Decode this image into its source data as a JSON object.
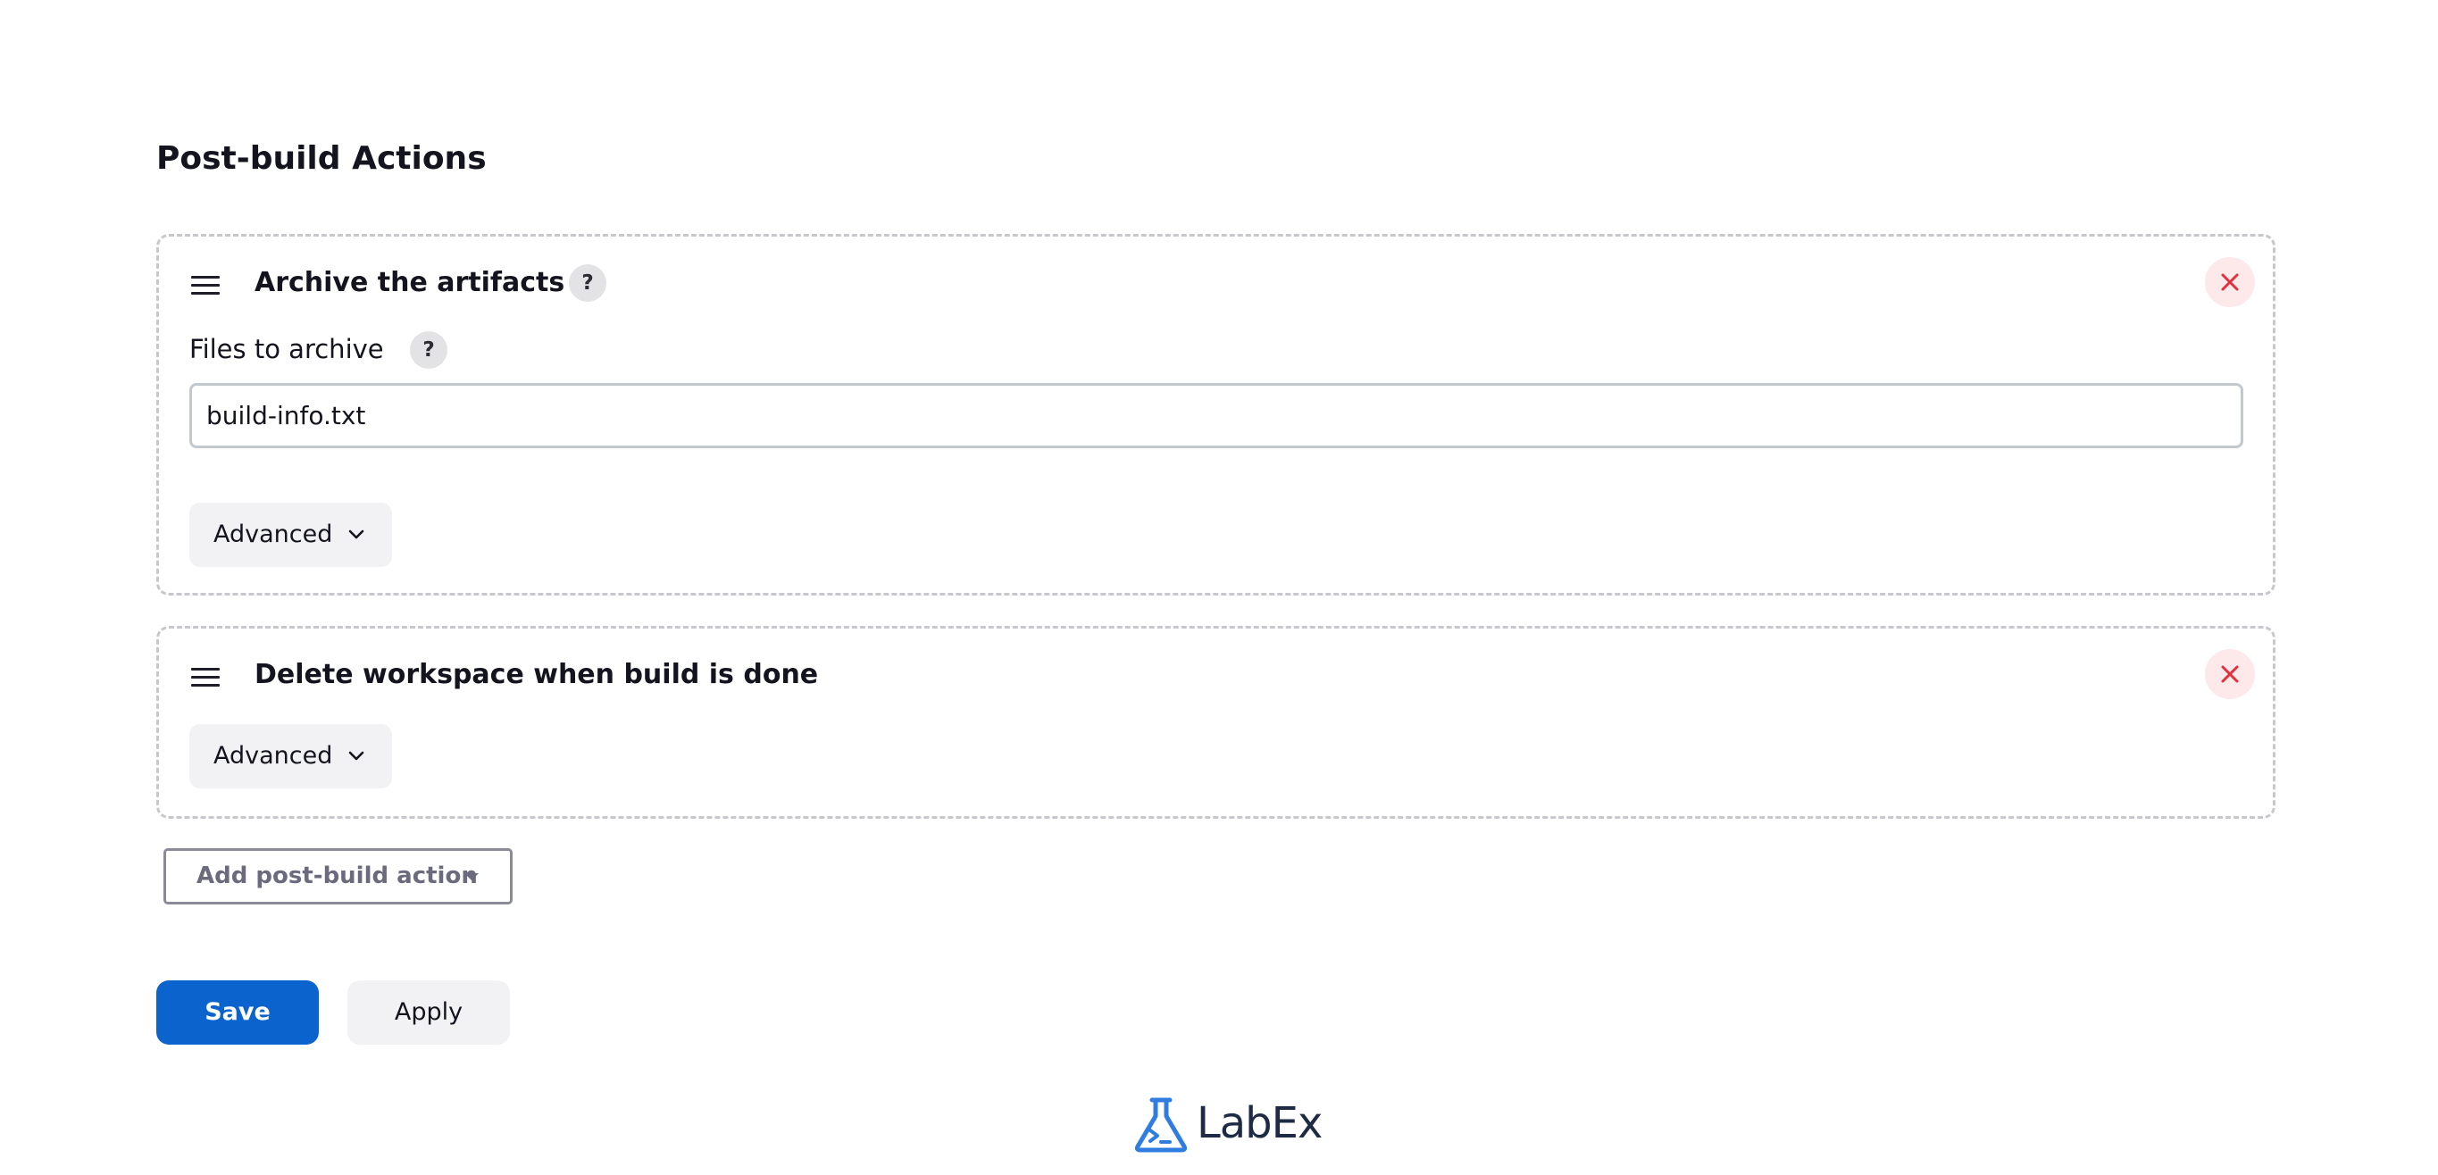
{
  "section": {
    "title": "Post-build Actions"
  },
  "actions": [
    {
      "title": "Archive the artifacts",
      "help": "?",
      "field_label": "Files to archive",
      "field_help": "?",
      "field_value": "build-info.txt",
      "advanced_label": "Advanced"
    },
    {
      "title": "Delete workspace when build is done",
      "advanced_label": "Advanced"
    }
  ],
  "add_action": {
    "label": "Add post-build action"
  },
  "buttons": {
    "save": "Save",
    "apply": "Apply"
  },
  "logo": {
    "text": "LabEx"
  },
  "colors": {
    "primary": "#0b63ce",
    "close_icon": "#e0323e",
    "logo_blue": "#2f7de1"
  }
}
